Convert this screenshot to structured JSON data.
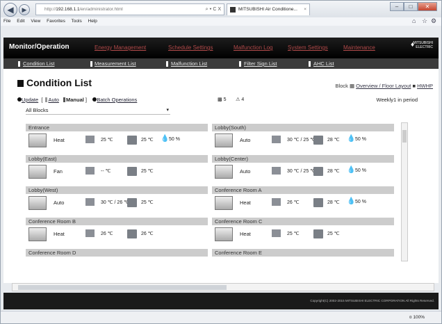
{
  "browser": {
    "address_dim": "http://",
    "address_host": "192.168.1.1",
    "address_path": "/en/administrator.html",
    "address_icons": "⌕ ▾ C X",
    "tab_title": "MITSUBISHI Air Conditione...",
    "tab_close": "×",
    "menu": [
      "File",
      "Edit",
      "View",
      "Favorites",
      "Tools",
      "Help"
    ],
    "zoom": "¤ 100%",
    "window_controls": [
      "–",
      "□",
      "✕"
    ]
  },
  "header": {
    "title": "Monitor/Operation",
    "menus": [
      "Energy Management",
      "Schedule Settings",
      "Malfunction Log",
      "System Settings",
      "Maintenance"
    ],
    "logo": "MITSUBISHI ELECTRIC"
  },
  "subnav": [
    "Condition List",
    "Measurement List",
    "Malfunction List",
    "Filter Sign List",
    "AHC List"
  ],
  "page": {
    "title": "Condition List",
    "block_label": "Block",
    "overview_link": "Overview / Floor Layout",
    "hwhp_link": "HWHP",
    "update": "Update",
    "bracket_open": "[",
    "auto": "Auto",
    "manual": "Manual",
    "bracket_close": "]",
    "batch": "Batch Operations",
    "count1": "5",
    "count2": "4",
    "period": "Weekly1 in period",
    "select_value": "All Blocks"
  },
  "rooms": [
    {
      "name": "Entrance",
      "mode": "Heat",
      "set": "25 ℃",
      "room": "25 ℃",
      "hum": "50 %"
    },
    {
      "name": "Lobby(South)",
      "mode": "Auto",
      "set": "30 ℃ / 25 ℃",
      "room": "28 ℃",
      "hum": "50 %"
    },
    {
      "name": "Lobby(East)",
      "mode": "Fan",
      "set": "-- ℃",
      "room": "25 ℃",
      "hum": ""
    },
    {
      "name": "Lobby(Center)",
      "mode": "Auto",
      "set": "30 ℃ / 25 ℃",
      "room": "28 ℃",
      "hum": "50 %"
    },
    {
      "name": "Lobby(West)",
      "mode": "Auto",
      "set": "30 ℃ / 26 ℃",
      "room": "25 ℃",
      "hum": ""
    },
    {
      "name": "Conference Room A",
      "mode": "Heat",
      "set": "26 ℃",
      "room": "28 ℃",
      "hum": "50 %"
    },
    {
      "name": "Conference Room B",
      "mode": "Heat",
      "set": "26 ℃",
      "room": "26 ℃",
      "hum": ""
    },
    {
      "name": "Conference Room C",
      "mode": "Heat",
      "set": "25 ℃",
      "room": "25 ℃",
      "hum": ""
    },
    {
      "name": "Conference Room D",
      "mode": "",
      "set": "",
      "room": "",
      "hum": ""
    },
    {
      "name": "Conference Room E",
      "mode": "",
      "set": "",
      "room": "",
      "hum": ""
    }
  ],
  "footer": {
    "copyright": "Copyright(C) 2002-2015 MITSUBISHI ELECTRIC CORPORATION All Rights Reserved."
  }
}
